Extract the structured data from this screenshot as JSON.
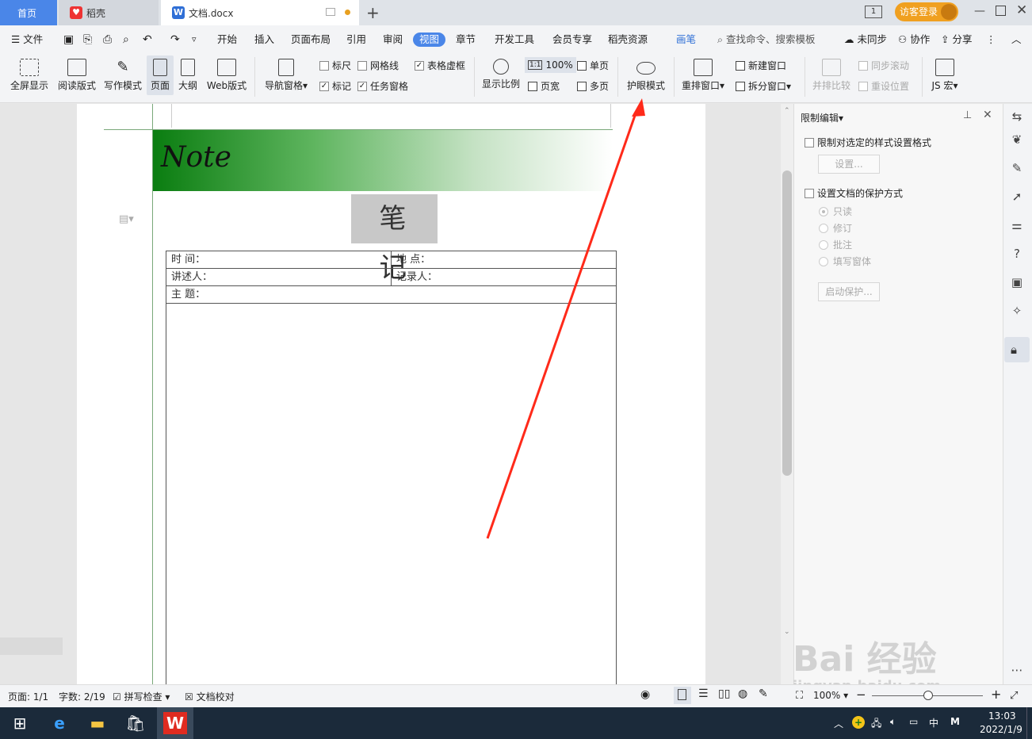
{
  "tabs": {
    "home": "首页",
    "daoke": "稻壳",
    "doc": "文档.docx",
    "add": "+"
  },
  "titlebar": {
    "login": "访客登录",
    "tab_count": "1"
  },
  "menu": {
    "file": "文件",
    "items": [
      "开始",
      "插入",
      "页面布局",
      "引用",
      "审阅",
      "视图",
      "章节",
      "开发工具",
      "会员专享",
      "稻壳资源"
    ],
    "pen": "画笔",
    "search": "查找命令、搜索模板",
    "unsync": "未同步",
    "collab": "协作",
    "share": "分享"
  },
  "ribbon": {
    "fullscreen": "全屏显示",
    "read": "阅读版式",
    "write": "写作模式",
    "page": "页面",
    "outline": "大纲",
    "web": "Web版式",
    "nav": "导航窗格",
    "ruler": "标尺",
    "grid": "网格线",
    "table_dash": "表格虚框",
    "mark": "标记",
    "taskpane": "任务窗格",
    "zoom": "显示比例",
    "zoom100": "100%",
    "zoom100_icon": "1:1",
    "single": "单页",
    "pagewidth": "页宽",
    "multi": "多页",
    "eye": "护眼模式",
    "rearrange": "重排窗口",
    "newwin": "新建窗口",
    "split": "拆分窗口",
    "side_compare": "并排比较",
    "sync_scroll": "同步滚动",
    "reset_pos": "重设位置",
    "js": "JS 宏"
  },
  "document": {
    "banner": "Note",
    "title": "笔 记",
    "time": "时  间：",
    "place": "地  点：",
    "speaker": "讲述人：",
    "recorder": "记录人：",
    "topic": "主  题："
  },
  "panel": {
    "title": "限制编辑",
    "opt1": "限制对选定的样式设置格式",
    "settings": "设置...",
    "opt2": "设置文档的保护方式",
    "readonly": "只读",
    "revise": "修订",
    "comment": "批注",
    "fillform": "填写窗体",
    "start": "启动保护..."
  },
  "status": {
    "page": "页面: 1/1",
    "words": "字数: 2/19",
    "spell": "拼写检查",
    "proof": "文档校对",
    "zoom": "100%"
  },
  "taskbar": {
    "time": "13:03",
    "date": "2022/1/9",
    "ime": "中",
    "ime2": "M"
  },
  "watermark": {
    "text": "Bai 经验",
    "url": "jingyan.baidu.com"
  },
  "colors": {
    "accent": "#4a86e8",
    "banner_green": "#0a7d10",
    "arrow": "#ff2a1a",
    "login_bg": "#f0a020"
  }
}
